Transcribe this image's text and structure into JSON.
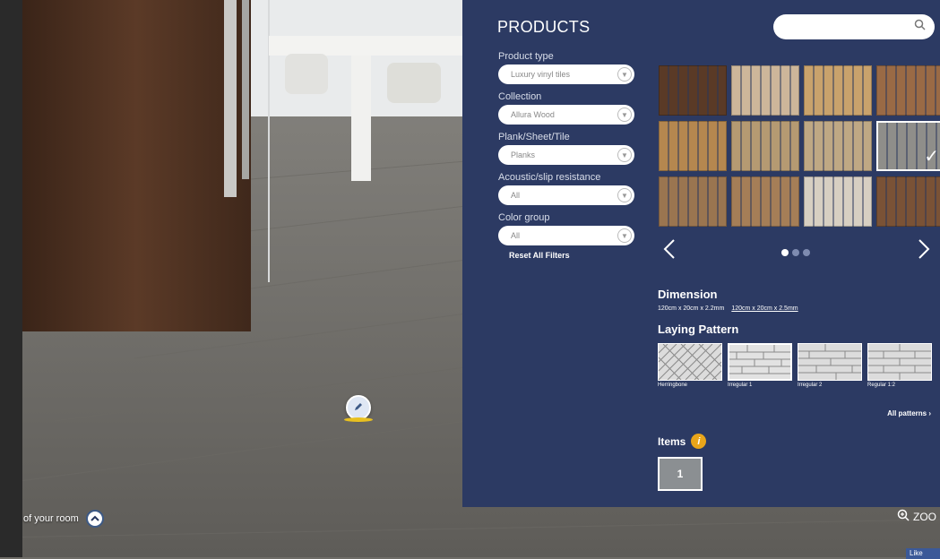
{
  "room": {
    "label_text": "of your room",
    "toggle_icon": "chevron-up-icon",
    "zoom_label": "ZOO"
  },
  "facebook": {
    "like_label": "Like"
  },
  "panel": {
    "title": "PRODUCTS",
    "search": {
      "value": "",
      "placeholder": ""
    },
    "background_color": "#2c3a63",
    "filters": [
      {
        "label": "Product type",
        "value": "Luxury vinyl tiles"
      },
      {
        "label": "Collection",
        "value": "Allura Wood"
      },
      {
        "label": "Plank/Sheet/Tile",
        "value": "Planks"
      },
      {
        "label": "Acoustic/slip resistance",
        "value": "All"
      },
      {
        "label": "Color group",
        "value": "All"
      }
    ],
    "reset_label": "Reset All Filters",
    "swatches": [
      {
        "color": "#5a3a26",
        "selected": false
      },
      {
        "color": "#cdb69a",
        "selected": false
      },
      {
        "color": "#c9a26c",
        "selected": false
      },
      {
        "color": "#9a6a45",
        "selected": false
      },
      {
        "color": "#b5874f",
        "selected": false
      },
      {
        "color": "#b59a72",
        "selected": false
      },
      {
        "color": "#bfa884",
        "selected": false
      },
      {
        "color": "#8f8e8a",
        "selected": true
      },
      {
        "color": "#9a7550",
        "selected": false
      },
      {
        "color": "#a57e57",
        "selected": false
      },
      {
        "color": "#d7cfc2",
        "selected": false
      },
      {
        "color": "#7a5236",
        "selected": false
      }
    ],
    "pager": {
      "pages": 3,
      "current": 1
    },
    "dimension": {
      "title": "Dimension",
      "options": [
        {
          "label": "120cm x 20cm x 2.2mm",
          "selected": false
        },
        {
          "label": "120cm x 20cm x 2.5mm",
          "selected": true
        }
      ]
    },
    "laying": {
      "title": "Laying Pattern",
      "patterns": [
        {
          "label": "Herringbone",
          "selected": false
        },
        {
          "label": "Irregular 1",
          "selected": true
        },
        {
          "label": "Irregular 2",
          "selected": false
        },
        {
          "label": "Regular 1:2",
          "selected": false
        }
      ],
      "all_label": "All patterns"
    },
    "items": {
      "title": "Items",
      "info_icon": "info-icon",
      "list": [
        {
          "number": "1"
        }
      ]
    }
  }
}
